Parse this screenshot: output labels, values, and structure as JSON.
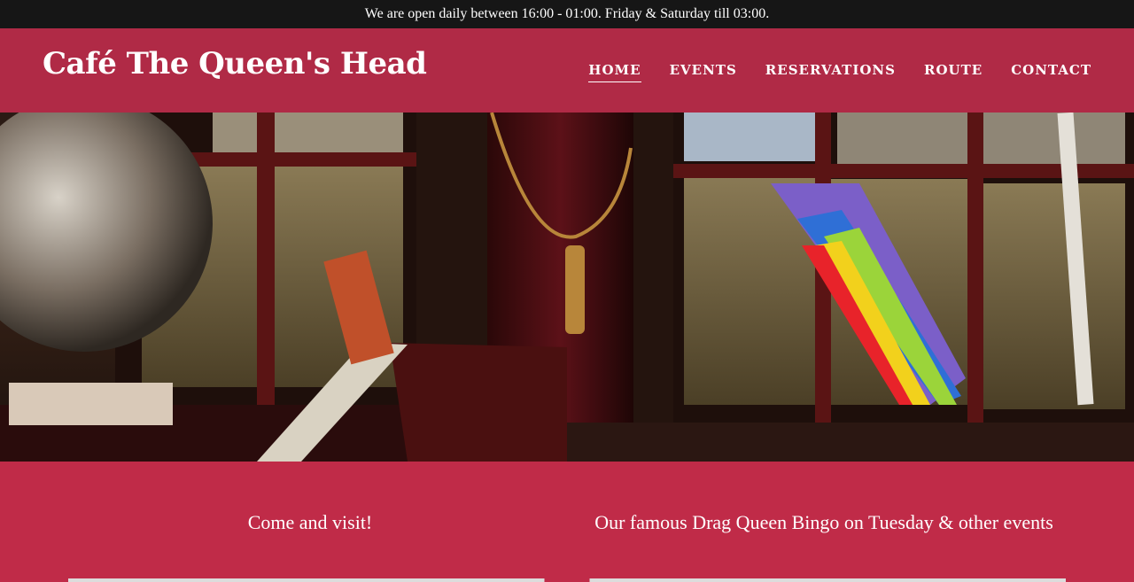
{
  "topbar": {
    "hours_text": "We are open daily between 16:00 - 01:00. Friday & Saturday till 03:00."
  },
  "header": {
    "brand": "Café The Queen's Head",
    "nav": [
      {
        "label": "HOME",
        "active": true
      },
      {
        "label": "EVENTS",
        "active": false
      },
      {
        "label": "RESERVATIONS",
        "active": false
      },
      {
        "label": "ROUTE",
        "active": false
      },
      {
        "label": "CONTACT",
        "active": false
      }
    ]
  },
  "sections": {
    "left_title": "Come and visit!",
    "right_title": "Our famous Drag Queen Bingo on Tuesday & other events"
  },
  "colors": {
    "topbar": "#161616",
    "header": "#b02a46",
    "section": "#c02b48",
    "text": "#ffffff"
  }
}
